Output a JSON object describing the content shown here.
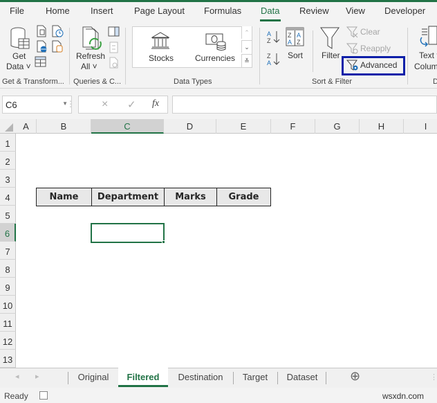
{
  "menu": {
    "tabs": [
      {
        "label": "File"
      },
      {
        "label": "Home"
      },
      {
        "label": "Insert"
      },
      {
        "label": "Page Layout"
      },
      {
        "label": "Formulas"
      },
      {
        "label": "Data",
        "active": true
      },
      {
        "label": "Review"
      },
      {
        "label": "View"
      },
      {
        "label": "Developer"
      }
    ]
  },
  "ribbon": {
    "get_transform": {
      "get_data_line1": "Get",
      "get_data_line2": "Data ˅",
      "group_label": "Get & Transform..."
    },
    "queries": {
      "refresh_line1": "Refresh",
      "refresh_line2": "All ˅",
      "group_label": "Queries & C..."
    },
    "data_types": {
      "stocks": "Stocks",
      "currencies": "Currencies",
      "group_label": "Data Types"
    },
    "sort_filter": {
      "sort": "Sort",
      "filter": "Filter",
      "clear": "Clear",
      "reapply": "Reapply",
      "advanced": "Advanced",
      "group_label": "Sort & Filter"
    },
    "data_tools": {
      "text_to_line1": "Text t",
      "text_to_line2": "Colum",
      "group_label": "D"
    }
  },
  "formula_bar": {
    "name_box": "C6",
    "cancel_icon": "×",
    "enter_icon": "✓",
    "fx_label": "fx",
    "value": ""
  },
  "columns": [
    "A",
    "B",
    "C",
    "D",
    "E",
    "F",
    "G",
    "H",
    "I"
  ],
  "selected_column": "C",
  "rows": [
    "1",
    "2",
    "3",
    "4",
    "5",
    "6",
    "7",
    "8",
    "9",
    "10",
    "11",
    "12",
    "13"
  ],
  "selected_row": "6",
  "table": {
    "headers": [
      "Name",
      "Department",
      "Marks",
      "Grade"
    ]
  },
  "sheets": {
    "tabs": [
      {
        "label": "Original"
      },
      {
        "label": "Filtered",
        "active": true
      },
      {
        "label": "Destination"
      },
      {
        "label": "Target"
      },
      {
        "label": "Dataset"
      }
    ],
    "add_icon": "⊕"
  },
  "status": {
    "ready": "Ready",
    "watermark": "wsxdn.com"
  },
  "colors": {
    "accent": "#217346",
    "highlight_box": "#0b1fa8"
  }
}
